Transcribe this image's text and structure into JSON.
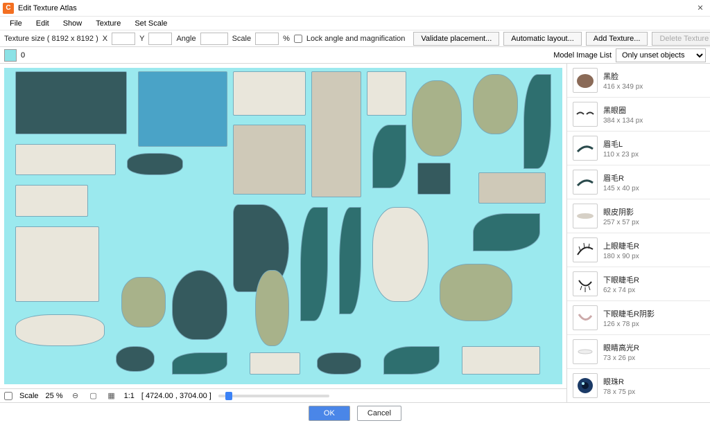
{
  "title": "Edit Texture Atlas",
  "menubar": [
    "File",
    "Edit",
    "Show",
    "Texture",
    "Set Scale"
  ],
  "toolbar": {
    "texture_size_label": "Texture size ( 8192 x 8192 )",
    "x_label": "X",
    "y_label": "Y",
    "angle_label": "Angle",
    "scale_label": "Scale",
    "percent_label": "%",
    "lock_label": "Lock angle and magnification",
    "validate": "Validate placement...",
    "auto": "Automatic layout...",
    "add": "Add Texture...",
    "delete": "Delete Texture"
  },
  "toolbar2": {
    "index": "0",
    "model_image_list_label": "Model Image List",
    "filter": "Only unset objects"
  },
  "status": {
    "scale_label": "Scale",
    "scale_value": "25 %",
    "ratio": "1:1",
    "coords": "[ 4724.00 , 3704.00 ]"
  },
  "footer": {
    "ok": "OK",
    "cancel": "Cancel"
  },
  "sidebar": [
    {
      "name": "黑脸",
      "size": "416 x 349 px",
      "thumb": "blob-brown"
    },
    {
      "name": "黑眼圈",
      "size": "384 x 134 px",
      "thumb": "eyes"
    },
    {
      "name": "眉毛L",
      "size": "110 x 23 px",
      "thumb": "brow"
    },
    {
      "name": "眉毛R",
      "size": "145 x 40 px",
      "thumb": "brow"
    },
    {
      "name": "眼皮阴影",
      "size": "257 x 57 px",
      "thumb": "shade"
    },
    {
      "name": "上眼睫毛R",
      "size": "180 x 90 px",
      "thumb": "lash-up"
    },
    {
      "name": "下眼睫毛R",
      "size": "62 x 74 px",
      "thumb": "lash-down"
    },
    {
      "name": "下眼睫毛R阴影",
      "size": "126 x 78 px",
      "thumb": "lash-shadow"
    },
    {
      "name": "眼睛高光R",
      "size": "73 x 26 px",
      "thumb": "highlight"
    },
    {
      "name": "眼珠R",
      "size": "78 x 75 px",
      "thumb": "eyeball"
    }
  ]
}
